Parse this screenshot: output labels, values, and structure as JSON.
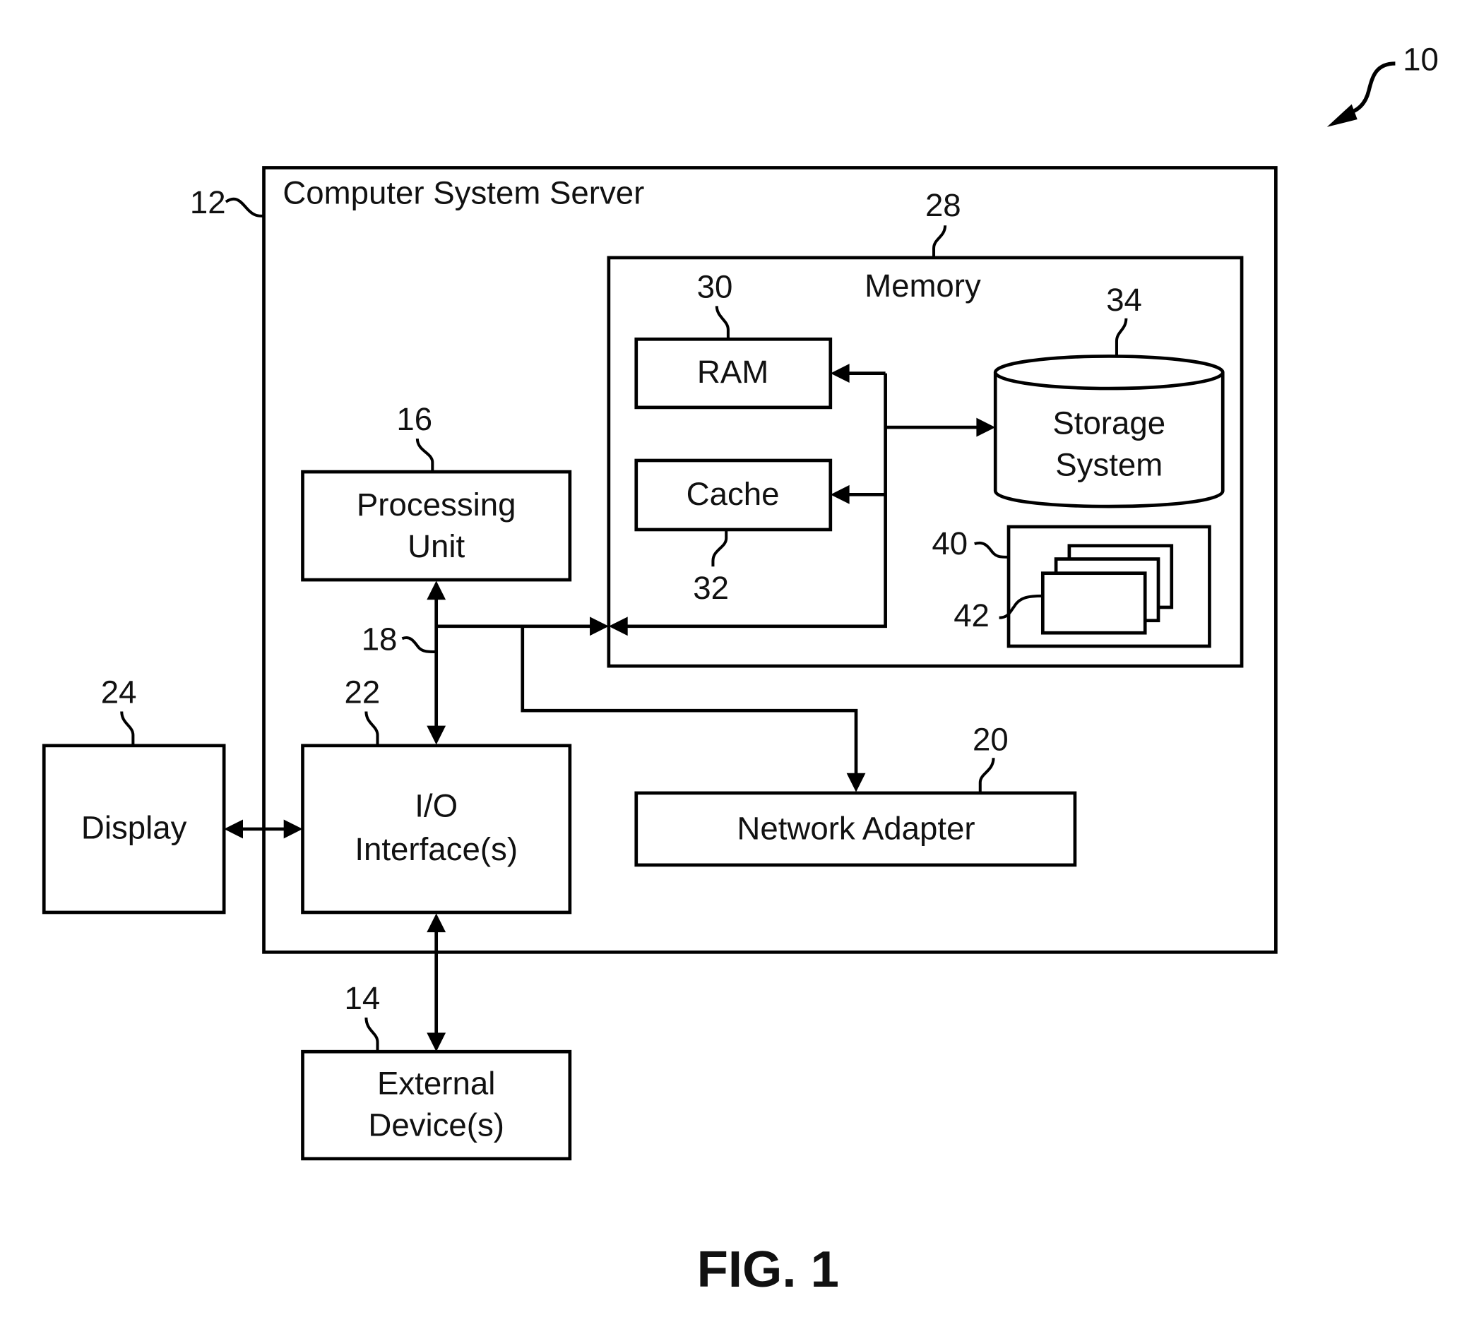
{
  "figure": {
    "caption": "FIG. 1",
    "reference": "10"
  },
  "server": {
    "ref": "12",
    "title": "Computer System Server"
  },
  "memory": {
    "ref": "28",
    "title": "Memory",
    "ram": {
      "ref": "30",
      "label": "RAM"
    },
    "cache": {
      "ref": "32",
      "label": "Cache"
    },
    "storage": {
      "ref": "34",
      "line1": "Storage",
      "line2": "System"
    },
    "program": {
      "ref": "40"
    },
    "modules": {
      "ref": "42"
    }
  },
  "processing": {
    "ref": "16",
    "line1": "Processing",
    "line2": "Unit"
  },
  "bus": {
    "ref": "18"
  },
  "network": {
    "ref": "20",
    "label": "Network Adapter"
  },
  "io": {
    "ref": "22",
    "line1": "I/O",
    "line2": "Interface(s)"
  },
  "display": {
    "ref": "24",
    "label": "Display"
  },
  "external": {
    "ref": "14",
    "line1": "External",
    "line2": "Device(s)"
  }
}
